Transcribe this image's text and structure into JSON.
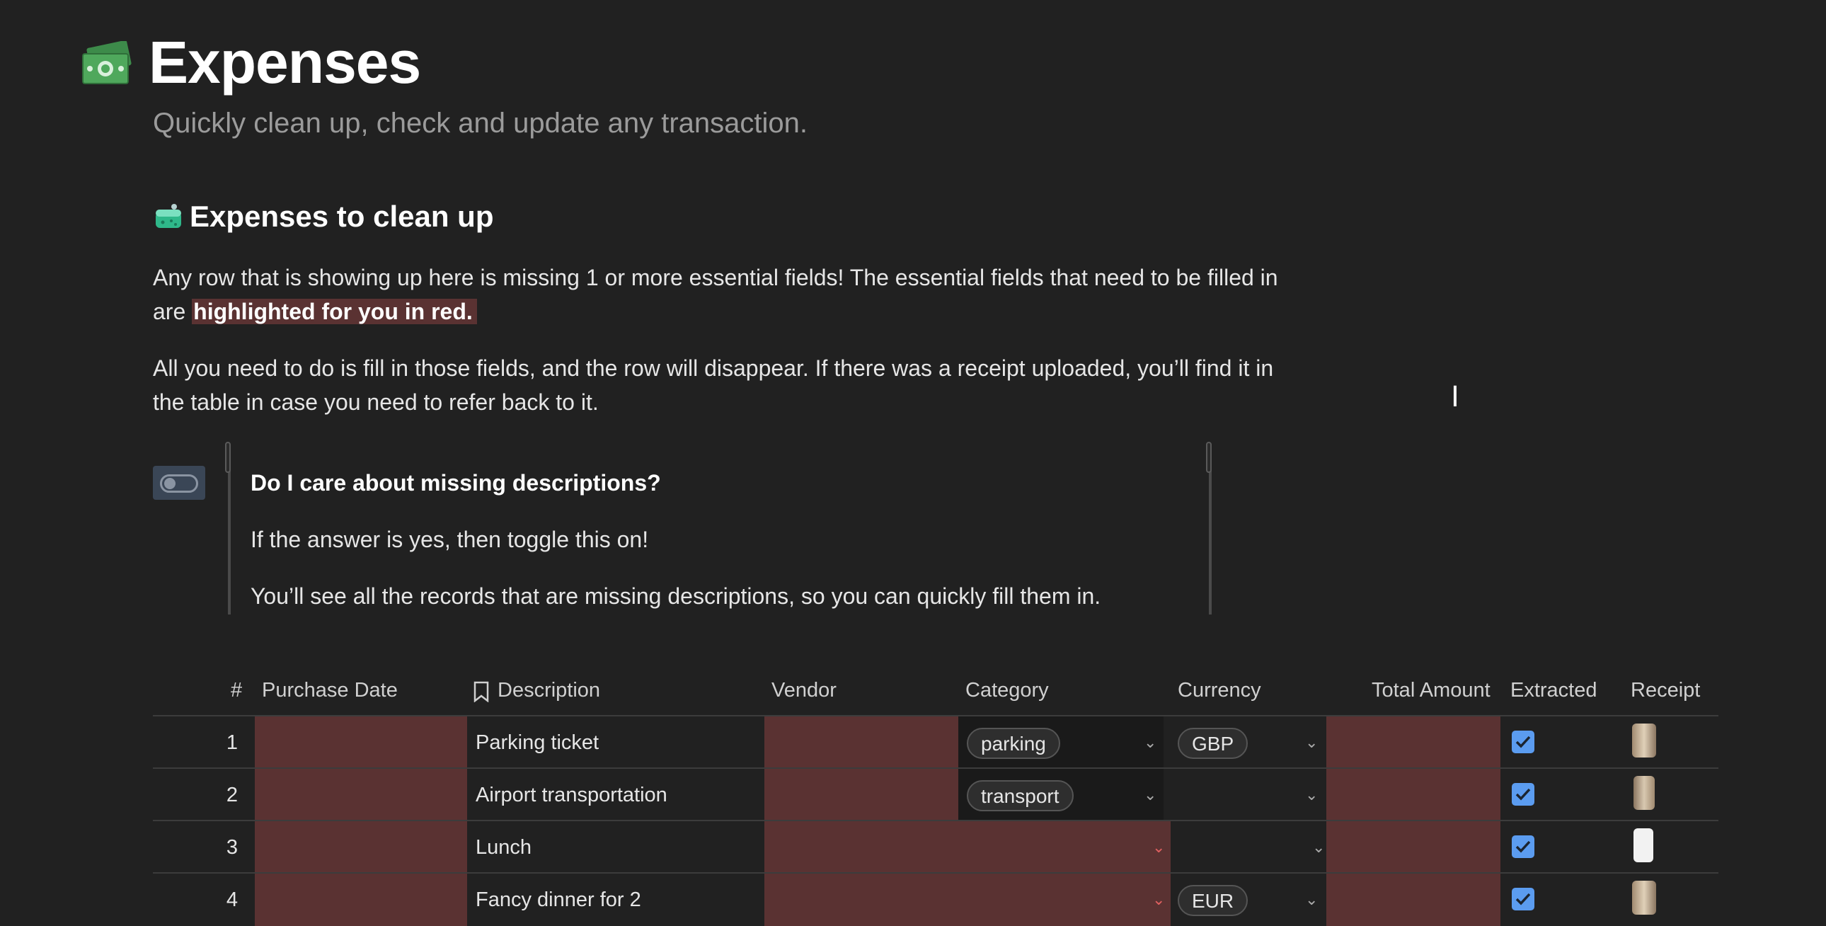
{
  "page": {
    "icon": "money-bills-icon",
    "title": "Expenses",
    "subtitle": "Quickly clean up, check and update any transaction."
  },
  "section": {
    "icon": "sponge-icon",
    "heading": "Expenses to clean up",
    "para1_prefix": "Any row that is showing up here is missing 1 or more essential fields! The essential fields that need to be filled in are ",
    "para1_highlight": "highlighted for you in red.",
    "para2": "All you need to do is fill in those fields, and the row will disappear. If there was a receipt uploaded, you’ll find it in the table in case you need to refer back to it."
  },
  "callout": {
    "title": "Do I care about missing descriptions?",
    "line1": "If the answer is yes, then toggle this on!",
    "line2": "You’ll see all the records that are missing descriptions, so you can quickly fill them in.",
    "toggle_on": false
  },
  "table": {
    "columns": [
      "#",
      "Purchase Date",
      "Description",
      "Vendor",
      "Category",
      "Currency",
      "Total Amount",
      "Extracted",
      "Receipt"
    ],
    "description_icon": "bookmark-icon",
    "missing_color": "#5a3232",
    "rows": [
      {
        "num": "1",
        "description": "Parking ticket",
        "category": "parking",
        "currency": "GBP",
        "extracted": true
      },
      {
        "num": "2",
        "description": "Airport transportation",
        "category": "transport",
        "currency": "",
        "extracted": true
      },
      {
        "num": "3",
        "description": "Lunch",
        "category": "",
        "currency": "",
        "extracted": true
      },
      {
        "num": "4",
        "description": "Fancy dinner for 2",
        "category": "",
        "currency": "EUR",
        "extracted": true
      }
    ]
  }
}
